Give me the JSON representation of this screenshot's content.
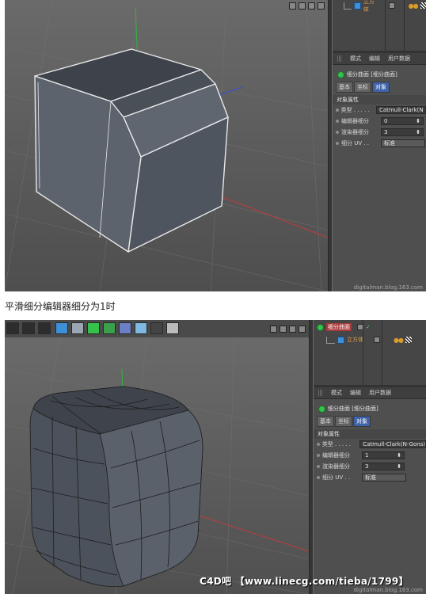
{
  "shot1": {
    "objects": [
      {
        "label": "立方体"
      }
    ],
    "menu": [
      "模式",
      "编辑",
      "用户数据"
    ],
    "object_title": "细分曲面 [细分曲面]",
    "tabs": [
      "基本",
      "坐标",
      "对象"
    ],
    "section": "对象属性",
    "props": [
      {
        "label": "类型 . . . . .",
        "value": "Catmull-Clark(N"
      },
      {
        "label": "编辑器细分",
        "value": "0"
      },
      {
        "label": "渲染器细分",
        "value": "3"
      },
      {
        "label": "细分 UV . .",
        "value": "标准"
      }
    ],
    "watermark": "digitalman.blog.163.com"
  },
  "caption": "平滑细分编辑器细分为1时",
  "shot2": {
    "objects": [
      {
        "label": "细分曲面"
      },
      {
        "label": "立方体"
      }
    ],
    "menu": [
      "模式",
      "编辑",
      "用户数据"
    ],
    "object_title": "细分曲面 [细分曲面]",
    "tabs": [
      "基本",
      "坐标",
      "对象"
    ],
    "section": "对象属性",
    "props": [
      {
        "label": "类型 . . . . .",
        "value": "Catmull-Clark(N-Gons)"
      },
      {
        "label": "编辑器细分",
        "value": "1"
      },
      {
        "label": "渲染器细分",
        "value": "3"
      },
      {
        "label": "细分 UV . .",
        "value": "标准"
      }
    ],
    "overlay": "C4D吧 【www.linecg.com/tieba/1799】",
    "watermark": "digitalman.blog.163.com"
  }
}
